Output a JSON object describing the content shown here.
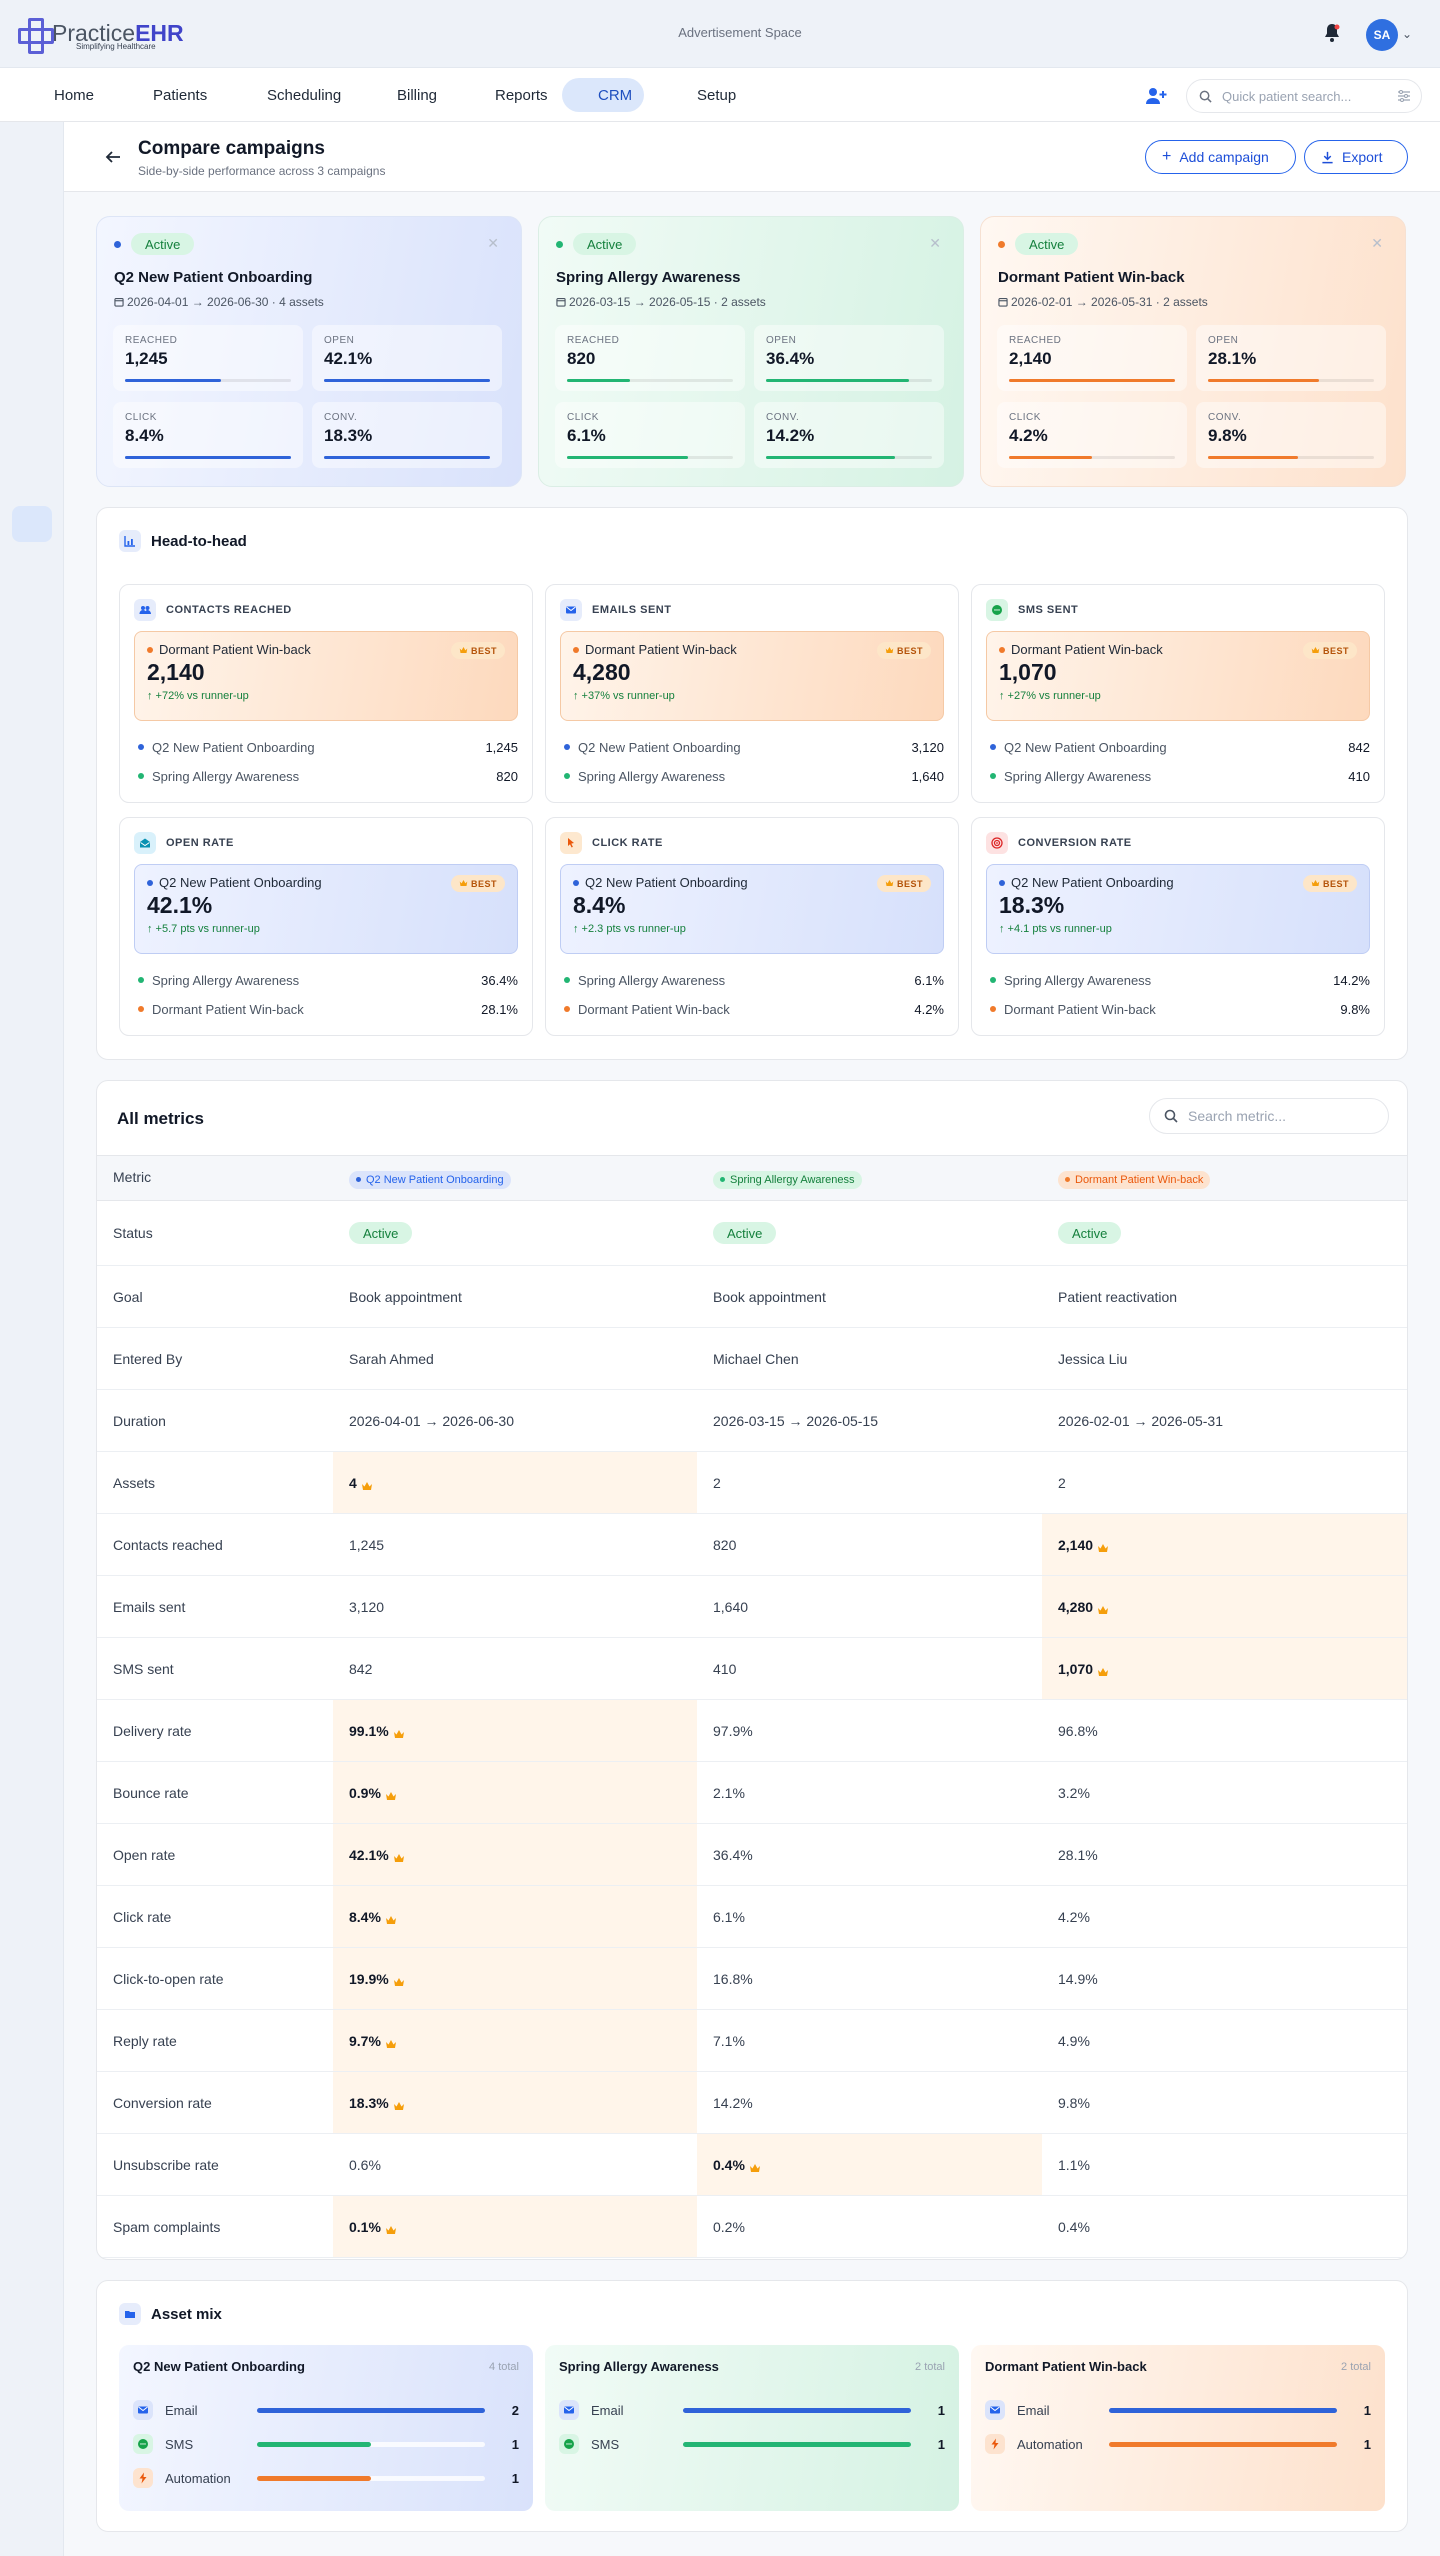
{
  "app": {
    "logo_practice": "Practice",
    "logo_ehr": "EHR",
    "tagline": "Simplifying Healthcare",
    "ad": "Advertisement Space",
    "user_initials": "SA"
  },
  "colors": {
    "primary": "#2563eb",
    "campaign_blue": "#2f63d9",
    "campaign_green": "#22b573",
    "campaign_orange": "#f07a2b",
    "best": "#f59e0b"
  },
  "nav": [
    {
      "label": "Home",
      "icon": "home-icon"
    },
    {
      "label": "Patients",
      "icon": "patients-icon"
    },
    {
      "label": "Scheduling",
      "icon": "calendar-icon"
    },
    {
      "label": "Billing",
      "icon": "billing-icon"
    },
    {
      "label": "Reports",
      "icon": "reports-icon"
    },
    {
      "label": "CRM",
      "icon": "megaphone-icon",
      "active": true
    },
    {
      "label": "Setup",
      "icon": "gear-icon"
    }
  ],
  "quick_search_placeholder": "Quick patient search...",
  "sidebar_icons": [
    "chart-icon",
    "contacts-icon",
    "inbox-icon",
    "layers-icon",
    "check-circle-icon",
    "list-icon",
    "bolt-icon",
    "lines-icon",
    "megaphone-icon"
  ],
  "page": {
    "title": "Compare campaigns",
    "subtitle": "Side-by-side performance across 3 campaigns",
    "add_label": "Add campaign",
    "export_label": "Export"
  },
  "campaigns": [
    {
      "status": "Active",
      "name": "Q2 New Patient Onboarding",
      "dates": "2026-04-01 → 2026-06-30 · 4 assets",
      "metrics": [
        {
          "label": "REACHED",
          "value": "1,245",
          "fill": 0.58
        },
        {
          "label": "OPEN",
          "value": "42.1%",
          "fill": 1
        },
        {
          "label": "CLICK",
          "value": "8.4%",
          "fill": 1
        },
        {
          "label": "CONV.",
          "value": "18.3%",
          "fill": 1
        }
      ]
    },
    {
      "status": "Active",
      "name": "Spring Allergy Awareness",
      "dates": "2026-03-15 → 2026-05-15 · 2 assets",
      "metrics": [
        {
          "label": "REACHED",
          "value": "820",
          "fill": 0.38
        },
        {
          "label": "OPEN",
          "value": "36.4%",
          "fill": 0.86
        },
        {
          "label": "CLICK",
          "value": "6.1%",
          "fill": 0.73
        },
        {
          "label": "CONV.",
          "value": "14.2%",
          "fill": 0.78
        }
      ]
    },
    {
      "status": "Active",
      "name": "Dormant Patient Win-back",
      "dates": "2026-02-01 → 2026-05-31 · 2 assets",
      "metrics": [
        {
          "label": "REACHED",
          "value": "2,140",
          "fill": 1
        },
        {
          "label": "OPEN",
          "value": "28.1%",
          "fill": 0.67
        },
        {
          "label": "CLICK",
          "value": "4.2%",
          "fill": 0.5
        },
        {
          "label": "CONV.",
          "value": "9.8%",
          "fill": 0.54
        }
      ]
    }
  ],
  "head_to_head": {
    "title": "Head-to-head",
    "best_label": "BEST",
    "cards": [
      {
        "label": "CONTACTS REACHED",
        "icon": "users-icon",
        "winner": "Dormant Patient Win-back",
        "winner_color": "orange",
        "value": "2,140",
        "delta": "↑ +72% vs runner-up",
        "others": [
          {
            "name": "Q2 New Patient Onboarding",
            "color": "blue",
            "value": "1,245"
          },
          {
            "name": "Spring Allergy Awareness",
            "color": "green",
            "value": "820"
          }
        ]
      },
      {
        "label": "EMAILS SENT",
        "icon": "mail-icon",
        "winner": "Dormant Patient Win-back",
        "winner_color": "orange",
        "value": "4,280",
        "delta": "↑ +37% vs runner-up",
        "others": [
          {
            "name": "Q2 New Patient Onboarding",
            "color": "blue",
            "value": "3,120"
          },
          {
            "name": "Spring Allergy Awareness",
            "color": "green",
            "value": "1,640"
          }
        ]
      },
      {
        "label": "SMS SENT",
        "icon": "chat-icon",
        "winner": "Dormant Patient Win-back",
        "winner_color": "orange",
        "value": "1,070",
        "delta": "↑ +27% vs runner-up",
        "others": [
          {
            "name": "Q2 New Patient Onboarding",
            "color": "blue",
            "value": "842"
          },
          {
            "name": "Spring Allergy Awareness",
            "color": "green",
            "value": "410"
          }
        ]
      },
      {
        "label": "OPEN RATE",
        "icon": "envelope-open-icon",
        "winner": "Q2 New Patient Onboarding",
        "winner_color": "blue",
        "value": "42.1%",
        "delta": "↑ +5.7 pts vs runner-up",
        "others": [
          {
            "name": "Spring Allergy Awareness",
            "color": "green",
            "value": "36.4%"
          },
          {
            "name": "Dormant Patient Win-back",
            "color": "orange",
            "value": "28.1%"
          }
        ]
      },
      {
        "label": "CLICK RATE",
        "icon": "pointer-icon",
        "winner": "Q2 New Patient Onboarding",
        "winner_color": "blue",
        "value": "8.4%",
        "delta": "↑ +2.3 pts vs runner-up",
        "others": [
          {
            "name": "Spring Allergy Awareness",
            "color": "green",
            "value": "6.1%"
          },
          {
            "name": "Dormant Patient Win-back",
            "color": "orange",
            "value": "4.2%"
          }
        ]
      },
      {
        "label": "CONVERSION RATE",
        "icon": "target-icon",
        "winner": "Q2 New Patient Onboarding",
        "winner_color": "blue",
        "value": "18.3%",
        "delta": "↑ +4.1 pts vs runner-up",
        "others": [
          {
            "name": "Spring Allergy Awareness",
            "color": "green",
            "value": "14.2%"
          },
          {
            "name": "Dormant Patient Win-back",
            "color": "orange",
            "value": "9.8%"
          }
        ]
      }
    ]
  },
  "all_metrics": {
    "title": "All metrics",
    "search_placeholder": "Search metric...",
    "header_metric": "Metric",
    "columns": [
      "Q2 New Patient Onboarding",
      "Spring Allergy Awareness",
      "Dormant Patient Win-back"
    ],
    "rows": [
      {
        "metric": "Status",
        "values": [
          "Active",
          "Active",
          "Active"
        ],
        "best": -1,
        "pill": true
      },
      {
        "metric": "Goal",
        "values": [
          "Book appointment",
          "Book appointment",
          "Patient reactivation"
        ],
        "best": -1
      },
      {
        "metric": "Entered By",
        "values": [
          "Sarah Ahmed",
          "Michael Chen",
          "Jessica Liu"
        ],
        "best": -1
      },
      {
        "metric": "Duration",
        "values": [
          "2026-04-01 → 2026-06-30",
          "2026-03-15 → 2026-05-15",
          "2026-02-01 → 2026-05-31"
        ],
        "best": -1
      },
      {
        "metric": "Assets",
        "values": [
          "4",
          "2",
          "2"
        ],
        "best": 0
      },
      {
        "metric": "Contacts reached",
        "values": [
          "1,245",
          "820",
          "2,140"
        ],
        "best": 2
      },
      {
        "metric": "Emails sent",
        "values": [
          "3,120",
          "1,640",
          "4,280"
        ],
        "best": 2
      },
      {
        "metric": "SMS sent",
        "values": [
          "842",
          "410",
          "1,070"
        ],
        "best": 2
      },
      {
        "metric": "Delivery rate",
        "values": [
          "99.1%",
          "97.9%",
          "96.8%"
        ],
        "best": 0
      },
      {
        "metric": "Bounce rate",
        "values": [
          "0.9%",
          "2.1%",
          "3.2%"
        ],
        "best": 0
      },
      {
        "metric": "Open rate",
        "values": [
          "42.1%",
          "36.4%",
          "28.1%"
        ],
        "best": 0
      },
      {
        "metric": "Click rate",
        "values": [
          "8.4%",
          "6.1%",
          "4.2%"
        ],
        "best": 0
      },
      {
        "metric": "Click-to-open rate",
        "values": [
          "19.9%",
          "16.8%",
          "14.9%"
        ],
        "best": 0
      },
      {
        "metric": "Reply rate",
        "values": [
          "9.7%",
          "7.1%",
          "4.9%"
        ],
        "best": 0
      },
      {
        "metric": "Conversion rate",
        "values": [
          "18.3%",
          "14.2%",
          "9.8%"
        ],
        "best": 0
      },
      {
        "metric": "Unsubscribe rate",
        "values": [
          "0.6%",
          "0.4%",
          "1.1%"
        ],
        "best": 1
      },
      {
        "metric": "Spam complaints",
        "values": [
          "0.1%",
          "0.2%",
          "0.4%"
        ],
        "best": 0
      }
    ]
  },
  "asset_mix": {
    "title": "Asset mix",
    "cards": [
      {
        "name": "Q2 New Patient Onboarding",
        "total": "4 total",
        "items": [
          {
            "label": "Email",
            "icon": "mail-icon",
            "count": "2",
            "fill": 1,
            "color": "blue"
          },
          {
            "label": "SMS",
            "icon": "chat-icon",
            "count": "1",
            "fill": 0.5,
            "color": "green"
          },
          {
            "label": "Automation",
            "icon": "bolt-icon",
            "count": "1",
            "fill": 0.5,
            "color": "orange"
          }
        ]
      },
      {
        "name": "Spring Allergy Awareness",
        "total": "2 total",
        "items": [
          {
            "label": "Email",
            "icon": "mail-icon",
            "count": "1",
            "fill": 1,
            "color": "blue"
          },
          {
            "label": "SMS",
            "icon": "chat-icon",
            "count": "1",
            "fill": 1,
            "color": "green"
          }
        ]
      },
      {
        "name": "Dormant Patient Win-back",
        "total": "2 total",
        "items": [
          {
            "label": "Email",
            "icon": "mail-icon",
            "count": "1",
            "fill": 1,
            "color": "blue"
          },
          {
            "label": "Automation",
            "icon": "bolt-icon",
            "count": "1",
            "fill": 1,
            "color": "orange"
          }
        ]
      }
    ]
  }
}
